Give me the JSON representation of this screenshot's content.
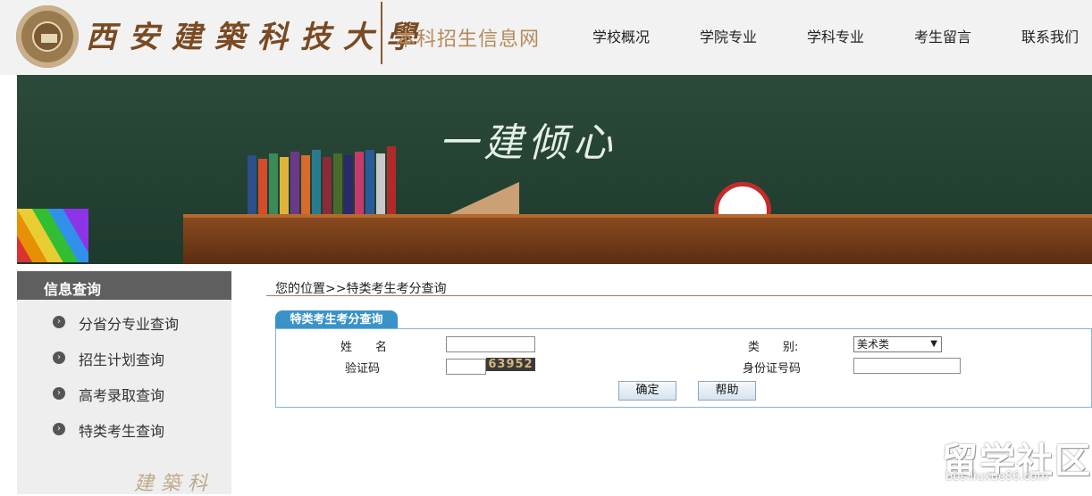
{
  "header": {
    "university_name": "西安建築科技大學",
    "site_title": "本科招生信息网",
    "nav": [
      "学校概况",
      "学院专业",
      "学科专业",
      "考生留言",
      "联系我们"
    ]
  },
  "banner": {
    "slogan": "一建倾心"
  },
  "sidebar": {
    "title": "信息查询",
    "items": [
      {
        "label": "分省分专业查询",
        "icon": "arrow-right-circle-icon"
      },
      {
        "label": "招生计划查询",
        "icon": "arrow-right-circle-icon"
      },
      {
        "label": "高考录取查询",
        "icon": "arrow-right-circle-icon"
      },
      {
        "label": "特类考生查询",
        "icon": "arrow-right-circle-icon"
      }
    ],
    "seal_text": "建築科"
  },
  "breadcrumb": "您的位置>>特类考生考分查询",
  "form": {
    "tab_title": "特类考生考分查询",
    "name_label": "姓　　名",
    "name_value": "",
    "category_label": "类　　别:",
    "category_selected": "美术类",
    "captcha_label": "验证码",
    "captcha_value": "",
    "captcha_image_text": "63952",
    "id_label": "身份证号码",
    "id_value": "",
    "submit_label": "确定",
    "help_label": "帮助"
  },
  "watermark": {
    "main": "留学社区",
    "sub": "bbs.liuxue86.com"
  }
}
